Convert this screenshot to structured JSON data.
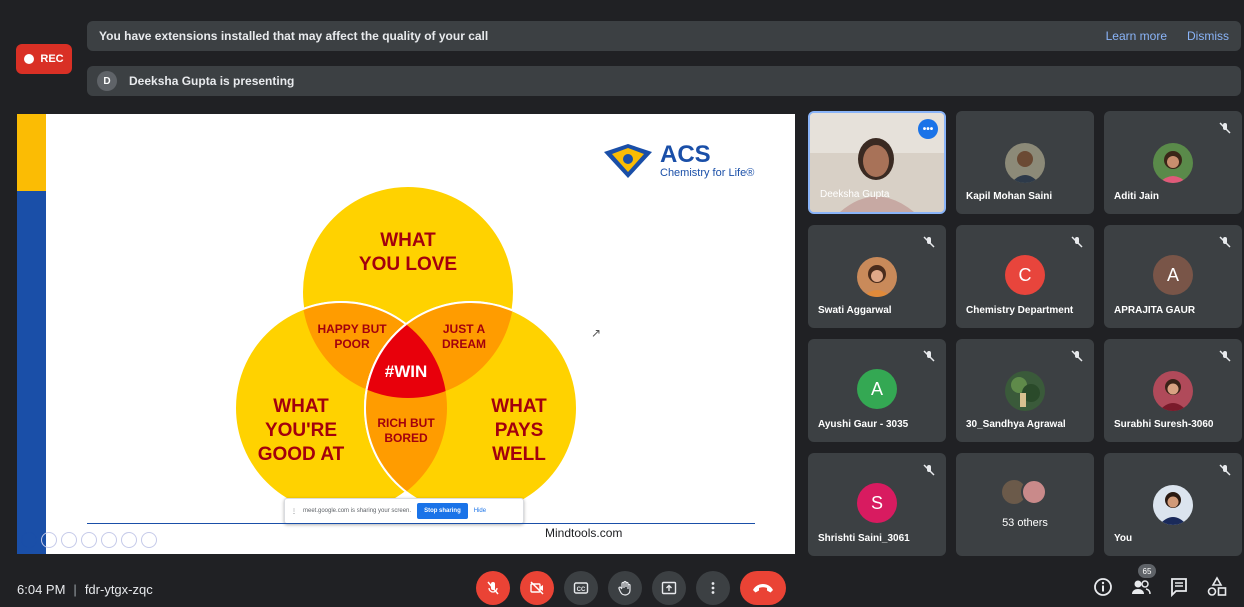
{
  "rec_label": "REC",
  "extension_banner": {
    "message": "You have extensions installed that may affect the quality of your call",
    "learn_more": "Learn more",
    "dismiss": "Dismiss"
  },
  "presenting_banner": {
    "avatar_letter": "D",
    "message": "Deeksha Gupta is presenting"
  },
  "slide": {
    "logo_title": "ACS",
    "logo_subtitle": "Chemistry for Life®",
    "venn": {
      "top": [
        "WHAT",
        "YOU LOVE"
      ],
      "left": [
        "WHAT",
        "YOU'RE",
        "GOOD AT"
      ],
      "right": [
        "WHAT",
        "PAYS",
        "WELL"
      ],
      "top_left": [
        "HAPPY BUT",
        "POOR"
      ],
      "top_right": [
        "JUST A",
        "DREAM"
      ],
      "bottom": [
        "RICH BUT",
        "BORED"
      ],
      "center": "#WIN"
    },
    "credit": "Mindtools.com",
    "share_bar": {
      "message": "meet.google.com is sharing your screen.",
      "stop": "Stop sharing",
      "hide": "Hide"
    }
  },
  "participants": [
    {
      "name": "Deeksha Gupta",
      "type": "video"
    },
    {
      "name": "Kapil Mohan Saini",
      "type": "photo"
    },
    {
      "name": "Aditi Jain",
      "type": "photo"
    },
    {
      "name": "Swati Aggarwal",
      "type": "photo"
    },
    {
      "name": "Chemistry Department",
      "type": "letter",
      "letter": "C",
      "color": "#e8453c"
    },
    {
      "name": "APRAJITA GAUR",
      "type": "letter",
      "letter": "A",
      "color": "#795548"
    },
    {
      "name": "Ayushi Gaur - 3035",
      "type": "letter",
      "letter": "A",
      "color": "#34a853"
    },
    {
      "name": "30_Sandhya Agrawal",
      "type": "photo"
    },
    {
      "name": "Surabhi Suresh-3060",
      "type": "photo"
    },
    {
      "name": "Shrishti Saini_3061",
      "type": "letter",
      "letter": "S",
      "color": "#d81b60"
    },
    {
      "name": "53 others",
      "type": "others"
    },
    {
      "name": "You",
      "type": "photo"
    }
  ],
  "bottom": {
    "time": "6:04 PM",
    "meeting_code": "fdr-ytgx-zqc",
    "participant_count": "65"
  },
  "colors": {
    "background": "#202124",
    "tile": "#3c4043",
    "danger": "#ea4335",
    "accent": "#8ab4f8"
  }
}
